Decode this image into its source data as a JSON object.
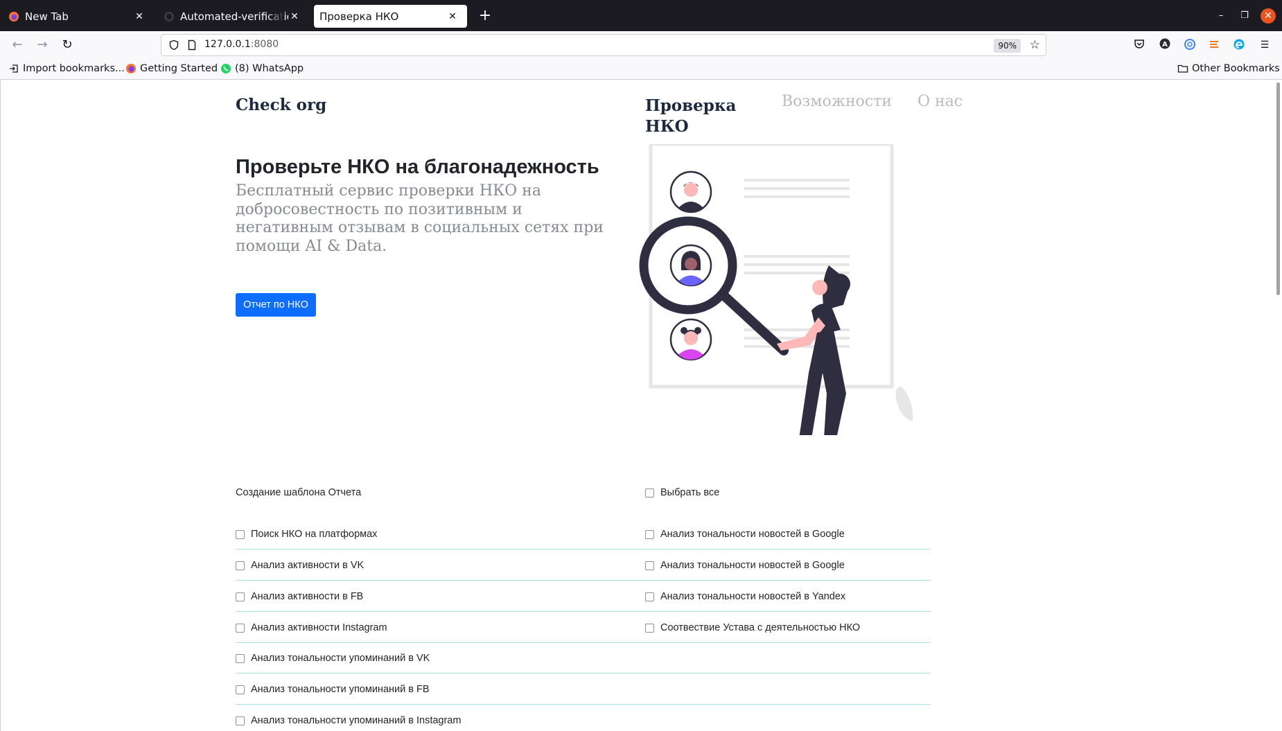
{
  "browser": {
    "tabs": [
      {
        "title": "New Tab",
        "active": false
      },
      {
        "title": "Automated-verification-o",
        "active": false
      },
      {
        "title": "Проверка НКО",
        "active": true
      }
    ],
    "url_host": "127.0.0.1",
    "url_port": ":8080",
    "zoom": "90%",
    "bookmarks": [
      "Import bookmarks...",
      "Getting Started",
      "(8) WhatsApp"
    ],
    "other_bookmarks": "Other Bookmarks"
  },
  "page": {
    "brand": "Check org",
    "nav": {
      "current": "Проверка НКО",
      "features": "Возможности",
      "about": "О нас"
    },
    "hero": {
      "title": "Проверьте НКО на благонадежность",
      "subtitle": "Бесплатный сервис проверки НКО на добросовестность по позитивным и негативным отзывам в социальных сетях при помощи AI & Data.",
      "button": "Отчет по НКО"
    },
    "report": {
      "section_label": "Создание шаблона Отчета",
      "select_all": "Выбрать все",
      "rows": [
        {
          "left": "Поиск НКО на платформах",
          "right": "Анализ тональности новостей в Google"
        },
        {
          "left": "Анализ активности в VK",
          "right": "Анализ тональности новостей в Google"
        },
        {
          "left": "Анализ активности в FB",
          "right": "Анализ тональности новостей в Yandex"
        },
        {
          "left": "Анализ активности Instagram",
          "right": "Соотвествие Устава с деятельностью НКО"
        },
        {
          "left": "Анализ тональности упоминаний в VK",
          "right": ""
        },
        {
          "left": "Анализ тональности упоминаний в FB",
          "right": ""
        },
        {
          "left": "Анализ тональности упоминаний в Instagram",
          "right": ""
        }
      ]
    }
  },
  "colors": {
    "primary": "#0d6efd",
    "brand_text": "#1c2a3d",
    "muted_nav": "#b8bcc2",
    "row_divider": "#a8dfe8",
    "illustration_dark": "#2f2e41",
    "illustration_accent": "#d946ef"
  }
}
